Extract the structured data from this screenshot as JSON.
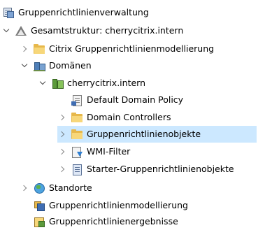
{
  "tree": {
    "root": {
      "label": "Gruppenrichtlinienverwaltung",
      "icon": "gpmc-icon"
    },
    "forest": {
      "label": "Gesamtstruktur: cherrycitrix.intern",
      "icon": "forest-icon",
      "expanded": true
    },
    "items": [
      {
        "label": "Citrix Gruppenrichtlinienmodellierung",
        "icon": "folder-icon",
        "expanded": false
      },
      {
        "label": "Domänen",
        "icon": "domains-icon",
        "expanded": true
      },
      {
        "label": "cherrycitrix.intern",
        "icon": "domain-icon",
        "expanded": true
      },
      {
        "label": "Default Domain Policy",
        "icon": "gpo-link-icon"
      },
      {
        "label": "Domain Controllers",
        "icon": "folder-icon",
        "expanded": false
      },
      {
        "label": "Gruppenrichtlinienobjekte",
        "icon": "folder-icon",
        "expanded": false,
        "selected": true
      },
      {
        "label": "WMI-Filter",
        "icon": "wmi-filter-icon",
        "expanded": false
      },
      {
        "label": "Starter-Gruppenrichtlinienobjekte",
        "icon": "starter-gpo-icon",
        "expanded": false
      },
      {
        "label": "Standorte",
        "icon": "sites-icon",
        "expanded": false
      },
      {
        "label": "Gruppenrichtlinienmodellierung",
        "icon": "modeling-icon"
      },
      {
        "label": "Gruppenrichtlinienergebnisse",
        "icon": "results-icon"
      }
    ]
  },
  "colors": {
    "selection": "#cce8ff",
    "folder": "#e7b84b"
  }
}
